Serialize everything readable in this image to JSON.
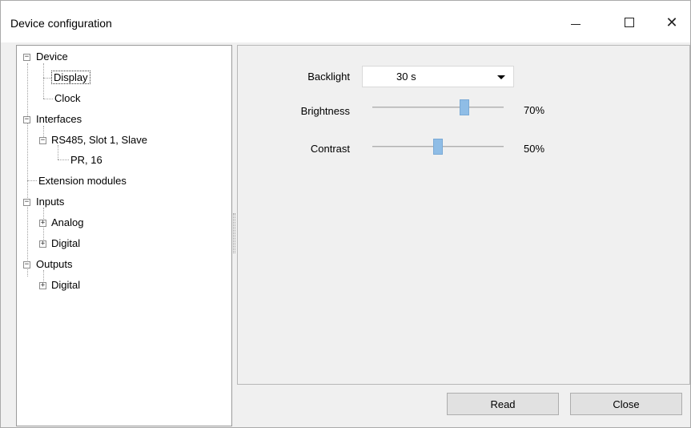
{
  "window": {
    "title": "Device configuration"
  },
  "tree": {
    "nodes": [
      {
        "label": "Device",
        "expander": "−"
      },
      {
        "label": "Display",
        "selected": true
      },
      {
        "label": "Clock"
      },
      {
        "label": "Interfaces",
        "expander": "−"
      },
      {
        "label": "RS485, Slot 1, Slave",
        "expander": "−"
      },
      {
        "label": "PR, 16"
      },
      {
        "label": "Extension modules"
      },
      {
        "label": "Inputs",
        "expander": "−"
      },
      {
        "label": "Analog",
        "expander": "+"
      },
      {
        "label": "Digital",
        "expander": "+"
      },
      {
        "label": "Outputs",
        "expander": "−"
      },
      {
        "label": "Digital",
        "expander": "+"
      }
    ]
  },
  "settings": {
    "backlight": {
      "label": "Backlight",
      "value": "30 s"
    },
    "brightness": {
      "label": "Brightness",
      "percent_text": "70%",
      "level": 0.7
    },
    "contrast": {
      "label": "Contrast",
      "percent_text": "50%",
      "level": 0.5
    }
  },
  "buttons": {
    "read": "Read",
    "close": "Close"
  },
  "icons": {
    "minimize": "minimize-icon",
    "maximize": "maximize-icon",
    "close": "close-icon",
    "dropdown": "chevron-down-icon"
  },
  "colors": {
    "slider_thumb": "#8fbde6",
    "selection_border": "#333333"
  }
}
